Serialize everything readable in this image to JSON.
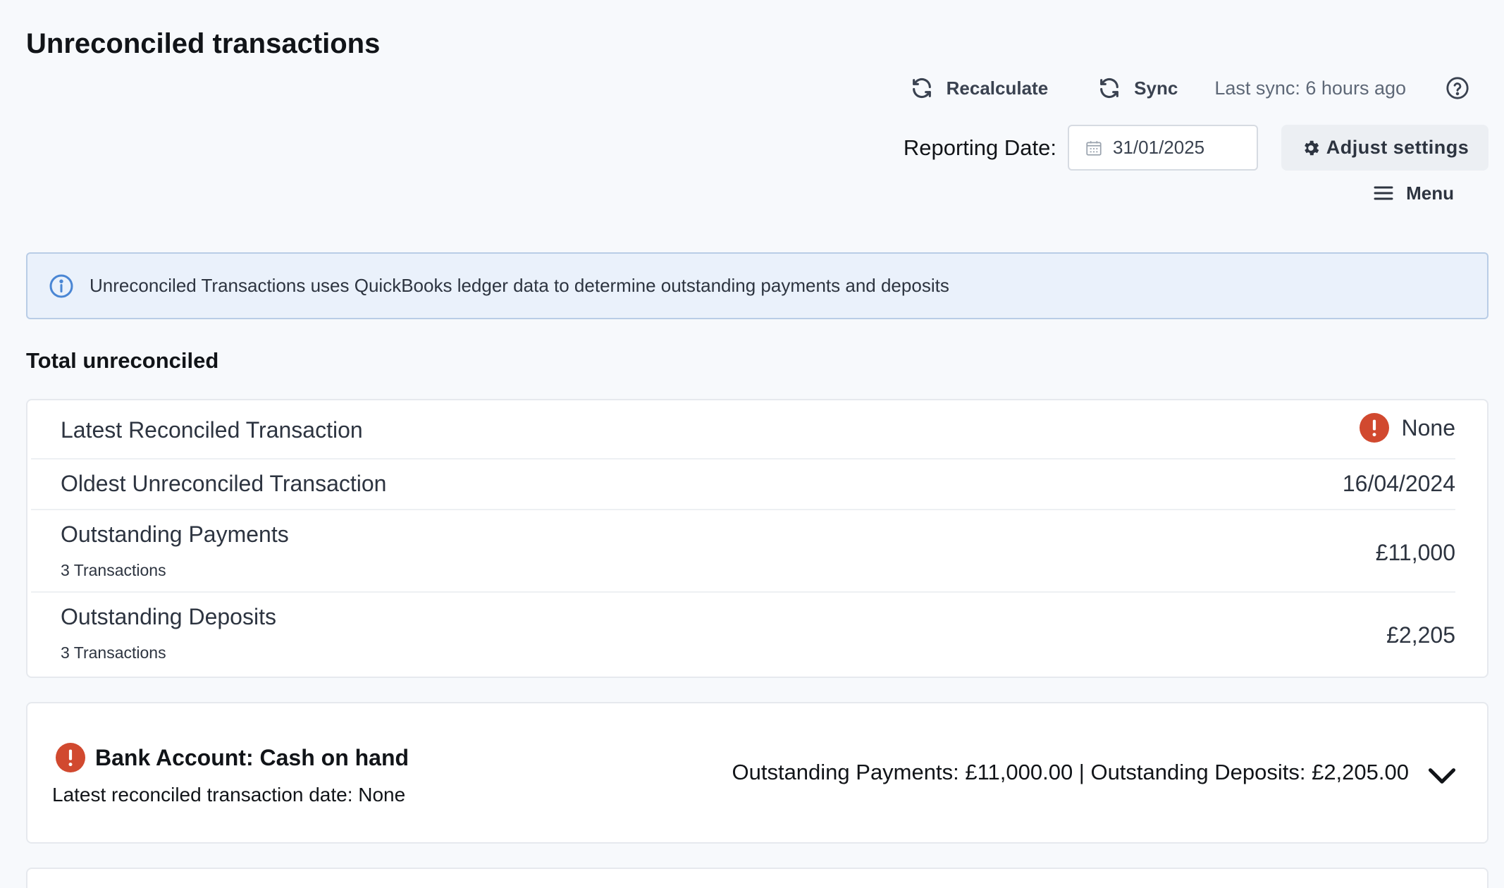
{
  "header": {
    "title": "Unreconciled transactions",
    "recalculate_label": "Recalculate",
    "sync_label": "Sync",
    "last_sync": "Last sync: 6 hours ago",
    "reporting_date_label": "Reporting Date:",
    "reporting_date_value": "31/01/2025",
    "adjust_settings_label": "Adjust settings",
    "menu_label": "Menu"
  },
  "info_banner": {
    "text": "Unreconciled Transactions uses QuickBooks ledger data to determine outstanding payments and deposits",
    "icon": "info-icon"
  },
  "summary": {
    "title": "Total unreconciled",
    "rows": [
      {
        "label": "Latest Reconciled Transaction",
        "sub": "",
        "value": "None",
        "icon": "alert-icon"
      },
      {
        "label": "Oldest Unreconciled Transaction",
        "sub": "",
        "value": "16/04/2024"
      },
      {
        "label": "Outstanding Payments",
        "sub": "3 Transactions",
        "value": "£11,000"
      },
      {
        "label": "Outstanding Deposits",
        "sub": "3 Transactions",
        "value": "£2,205"
      }
    ]
  },
  "accounts": [
    {
      "title": "Bank Account: Cash on hand",
      "latest_reconciled": "Latest reconciled transaction date: None",
      "summary": "Outstanding Payments: £11,000.00 | Outstanding Deposits: £2,205.00",
      "icon": "alert-icon",
      "expand_icon": "chevron-down-icon"
    }
  ],
  "colors": {
    "background": "#f7f9fc",
    "alert": "#d1492f",
    "info_blue": "#4a86d4",
    "banner_bg": "#eaf1fb"
  }
}
